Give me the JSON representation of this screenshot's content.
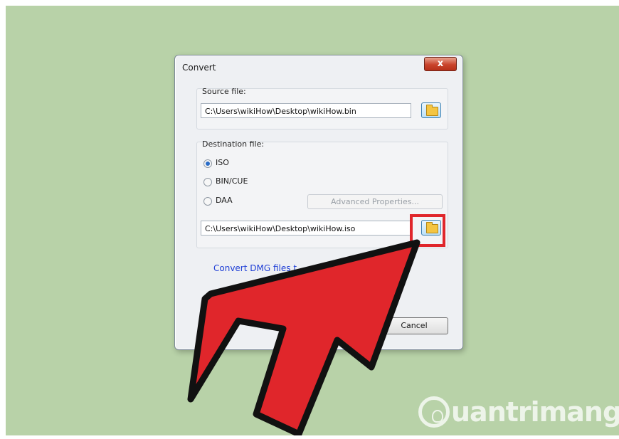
{
  "window": {
    "title": "Convert",
    "close_glyph": "x"
  },
  "source": {
    "label": "Source file:",
    "path": "C:\\Users\\wikiHow\\Desktop\\wikiHow.bin"
  },
  "destination": {
    "label": "Destination file:",
    "formats": [
      {
        "label": "ISO",
        "selected": true
      },
      {
        "label": "BIN/CUE",
        "selected": false
      },
      {
        "label": "DAA",
        "selected": false
      }
    ],
    "advanced_label": "Advanced Properties...",
    "path": "C:\\Users\\wikiHow\\Desktop\\wikiHow.iso"
  },
  "link_text": "Convert DMG files t",
  "cancel_label": "Cancel",
  "annotation": {
    "arrow_color": "#e0262b",
    "highlight_color": "#e0262b"
  },
  "watermark": {
    "text": "uantrimang"
  },
  "icons": [
    "close-icon",
    "folder-icon",
    "lightbulb-icon"
  ]
}
